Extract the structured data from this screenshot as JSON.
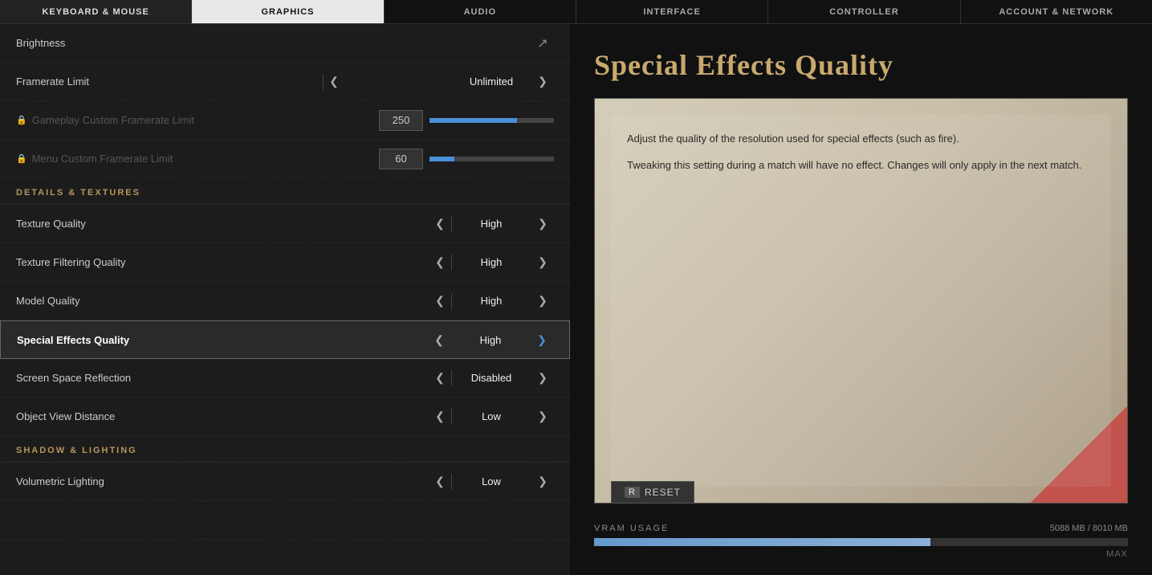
{
  "nav": {
    "items": [
      {
        "id": "keyboard-mouse",
        "label": "KEYBOARD & MOUSE",
        "active": false
      },
      {
        "id": "graphics",
        "label": "GRAPHICS",
        "active": true
      },
      {
        "id": "audio",
        "label": "AUDIO",
        "active": false
      },
      {
        "id": "interface",
        "label": "INTERFACE",
        "active": false
      },
      {
        "id": "controller",
        "label": "CONTROLLER",
        "active": false
      },
      {
        "id": "account-network",
        "label": "ACCOUNT & NETWORK",
        "active": false
      }
    ]
  },
  "left_panel": {
    "brightness": {
      "label": "Brightness"
    },
    "framerate_limit": {
      "label": "Framerate Limit",
      "value": "Unlimited"
    },
    "gameplay_framerate": {
      "label": "Gameplay Custom Framerate Limit",
      "value": "250",
      "fill_percent": 70,
      "locked": true,
      "disabled": true
    },
    "menu_framerate": {
      "label": "Menu Custom Framerate Limit",
      "value": "60",
      "fill_percent": 20,
      "locked": true,
      "disabled": true
    },
    "details_textures_header": "DETAILS & TEXTURES",
    "texture_quality": {
      "label": "Texture Quality",
      "value": "High"
    },
    "texture_filtering": {
      "label": "Texture Filtering Quality",
      "value": "High"
    },
    "model_quality": {
      "label": "Model Quality",
      "value": "High"
    },
    "special_effects": {
      "label": "Special Effects Quality",
      "value": "High",
      "active": true
    },
    "screen_space_reflection": {
      "label": "Screen Space Reflection",
      "value": "Disabled"
    },
    "object_view_distance": {
      "label": "Object View Distance",
      "value": "Low"
    },
    "shadow_lighting_header": "SHADOW & LIGHTING",
    "volumetric_lighting": {
      "label": "Volumetric Lighting",
      "value": "Low"
    }
  },
  "right_panel": {
    "title": "Special Effects Quality",
    "description_1": "Adjust the quality of the resolution used for special effects (such as fire).",
    "description_2": "Tweaking this setting during a match will have no effect. Changes will only apply in the next match.",
    "reset_label": "RESET",
    "reset_key": "R"
  },
  "vram": {
    "label": "VRAM USAGE",
    "used": "5088 MB",
    "total": "8010 MB",
    "value_display": "5088 MB / 8010 MB",
    "fill_percent": 63,
    "max_label": "MAX"
  }
}
